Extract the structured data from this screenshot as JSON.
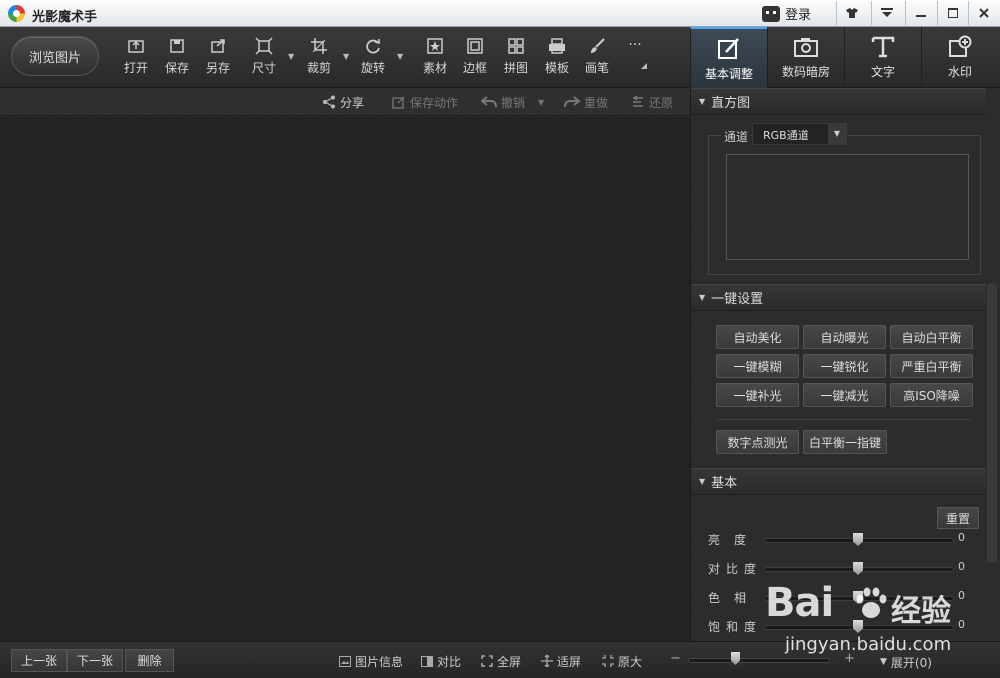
{
  "app": {
    "title": "光影魔术手",
    "login_label": "登录",
    "window_controls": [
      "skin-icon",
      "menu-icon",
      "minimize-icon",
      "maximize-icon",
      "close-icon"
    ]
  },
  "toolbar": {
    "browse_label": "浏览图片",
    "tools": [
      {
        "label": "打开",
        "icon": "open-icon"
      },
      {
        "label": "保存",
        "icon": "save-icon"
      },
      {
        "label": "另存",
        "icon": "save-as-icon"
      },
      {
        "label": "尺寸",
        "icon": "resize-icon"
      },
      {
        "label": "裁剪",
        "icon": "crop-icon"
      },
      {
        "label": "旋转",
        "icon": "rotate-icon"
      },
      {
        "label": "素材",
        "icon": "material-icon"
      },
      {
        "label": "边框",
        "icon": "border-icon"
      },
      {
        "label": "拼图",
        "icon": "collage-icon"
      },
      {
        "label": "模板",
        "icon": "template-icon"
      },
      {
        "label": "画笔",
        "icon": "brush-icon"
      },
      {
        "label": "···",
        "icon": "more-icon"
      }
    ],
    "tabs": [
      {
        "label": "基本调整",
        "icon": "basic-adjust-icon",
        "active": true
      },
      {
        "label": "数码暗房",
        "icon": "darkroom-icon",
        "active": false
      },
      {
        "label": "文字",
        "icon": "text-icon",
        "active": false
      },
      {
        "label": "水印",
        "icon": "watermark-icon",
        "active": false
      }
    ]
  },
  "actionbar": {
    "share": "分享",
    "save_action": "保存动作",
    "undo": "撤销",
    "redo": "重做",
    "restore": "还原"
  },
  "panel": {
    "histogram": {
      "title": "直方图",
      "channel_label": "通道",
      "channel_value": "RGB通道"
    },
    "one_click": {
      "title": "一键设置",
      "buttons": [
        "自动美化",
        "自动曝光",
        "自动白平衡",
        "一键模糊",
        "一键锐化",
        "严重白平衡",
        "一键补光",
        "一键减光",
        "高ISO降噪"
      ],
      "extra_buttons": [
        "数字点测光",
        "白平衡一指键"
      ]
    },
    "basic": {
      "title": "基本",
      "reset": "重置",
      "sliders": [
        {
          "label": "亮度",
          "value": "0"
        },
        {
          "label": "对比度",
          "value": "0"
        },
        {
          "label": "色相",
          "value": "0"
        },
        {
          "label": "饱和度",
          "value": "0"
        }
      ]
    }
  },
  "bottombar": {
    "prev": "上一张",
    "next": "下一张",
    "delete": "删除",
    "info": "图片信息",
    "compare": "对比",
    "fullscreen": "全屏",
    "fit": "适屏",
    "original": "原大",
    "zoom_minus": "−",
    "zoom_plus": "+",
    "expand": "展开(0)"
  },
  "watermark": {
    "brand": "Bai",
    "brand_cn": "经验",
    "url": "jingyan.baidu.com"
  }
}
